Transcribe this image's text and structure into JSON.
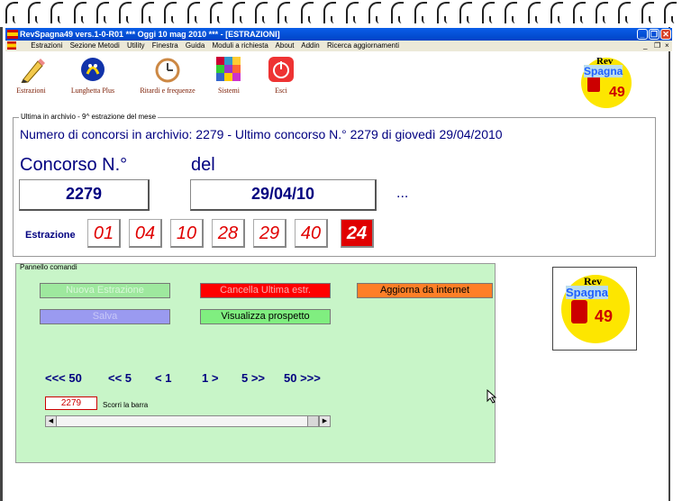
{
  "window": {
    "title": "RevSpagna49 vers.1-0-R01  ***  Oggi 10 mag 2010  ***  - [ESTRAZIONI]"
  },
  "menu": [
    "Estrazioni",
    "Sezione Metodi",
    "Utility",
    "Finestra",
    "Guida",
    "Moduli a richiesta",
    "About",
    "Addin",
    "Ricerca aggiornamenti"
  ],
  "toolbar": {
    "estrazioni": "Estrazioni",
    "lunghetta": "Lunghetta Plus",
    "ritardi": "Ritardi e frequenze",
    "sistemi": "Sistemi",
    "esci": "Esci"
  },
  "logo": {
    "line1": "Rev",
    "line2": "Spagna",
    "line3": "49"
  },
  "archive": {
    "legend": "Ultima in archivio - 9^ estrazione del mese",
    "info": "Numero di concorsi in archivio: 2279   -   Ultimo concorso N.° 2279 di giovedì 29/04/2010",
    "concorso_label": "Concorso N.°",
    "del_label": "del",
    "concorso_value": "2279",
    "date_value": "29/04/10",
    "ellipsis": "...",
    "estrazione_label": "Estrazione",
    "numbers": [
      "01",
      "04",
      "10",
      "28",
      "29",
      "40"
    ],
    "complementare": "24"
  },
  "panel": {
    "legend": "Pannello comandi",
    "nuova": "Nuova Estrazione",
    "cancella": "Cancella Ultima estr.",
    "aggiorna": "Aggiorna da internet",
    "salva": "Salva",
    "visualizza": "Visualizza prospetto",
    "nav": [
      "<<< 50",
      "<< 5",
      "< 1",
      "1 >",
      "5 >>",
      "50 >>>"
    ],
    "scroll_value": "2279",
    "scroll_label": "Scorri la barra"
  },
  "colors": {
    "accent_red": "#e00000",
    "navy": "#000080",
    "panel_green": "#c8f5c8"
  }
}
